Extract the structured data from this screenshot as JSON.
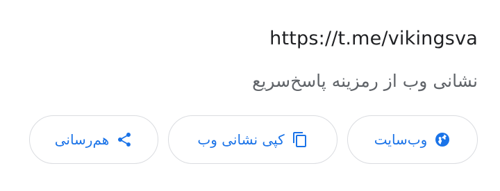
{
  "link_card": {
    "url": "https://t.me/vikingsva",
    "description": "نشانی وب از رمزینه پاسخ‌سریع"
  },
  "actions": [
    {
      "label": "وب‌سایت",
      "icon": "globe-icon"
    },
    {
      "label": "کپی نشانی وب",
      "icon": "copy-icon"
    },
    {
      "label": "هم‌رسانی",
      "icon": "share-icon"
    }
  ],
  "colors": {
    "accent": "#1a73e8",
    "chip_border": "#dadce0",
    "primary_text": "#202124",
    "secondary_text": "#5f6368"
  }
}
